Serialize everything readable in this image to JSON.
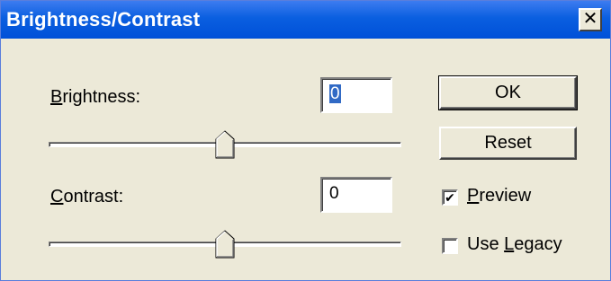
{
  "window": {
    "title": "Brightness/Contrast",
    "close_glyph": "✕"
  },
  "brightness": {
    "label_first": "B",
    "label_rest": "rightness:",
    "value_text": "0",
    "value": 0,
    "slider_fraction": 0.5
  },
  "contrast": {
    "label_first": "C",
    "label_rest": "ontrast:",
    "value_text": "0",
    "value": 0,
    "slider_fraction": 0.5
  },
  "buttons": {
    "ok": "OK",
    "reset": "Reset"
  },
  "preview": {
    "label_first": "P",
    "label_rest": "review",
    "checked": true,
    "check_glyph": "✔"
  },
  "use_legacy": {
    "label_prefix": "Use ",
    "label_under": "L",
    "label_rest": "egacy",
    "checked": false
  },
  "colors": {
    "title_bar": "#0a5fe0",
    "face": "#ece9d8",
    "selection": "#316ac5"
  },
  "icons": {
    "close": "close-icon",
    "slider_thumb": "slider-thumb-icon",
    "checkmark": "checkmark-icon"
  }
}
